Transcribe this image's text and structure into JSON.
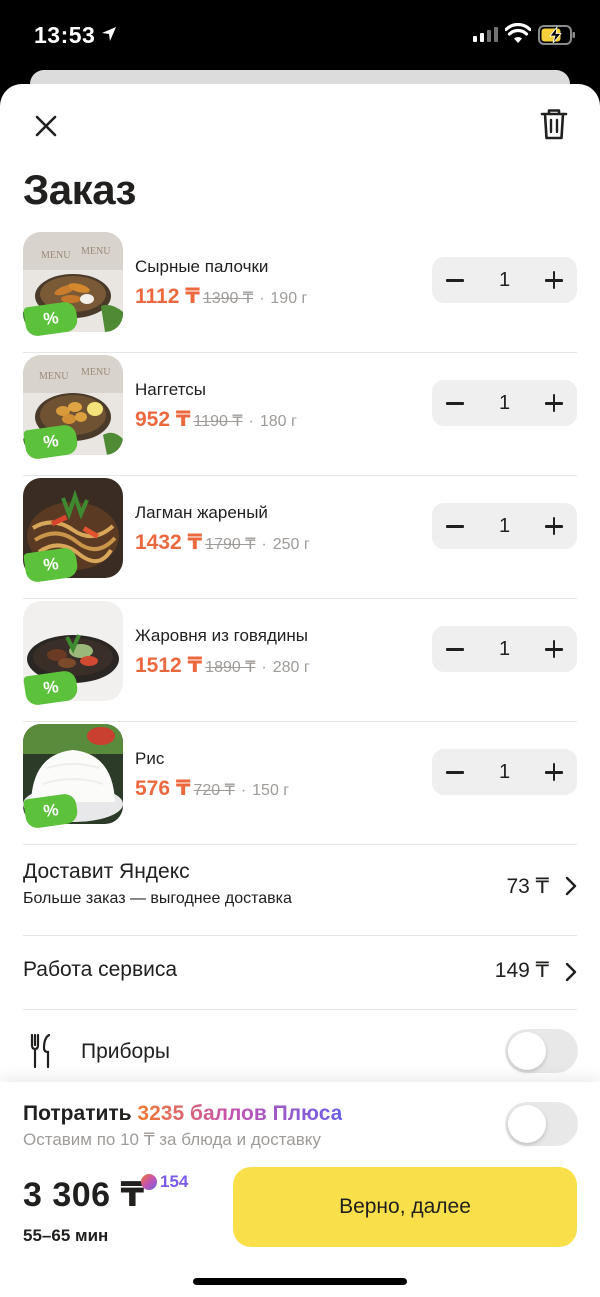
{
  "status_bar": {
    "time": "13:53"
  },
  "header": {
    "title": "Заказ"
  },
  "items": [
    {
      "name": "Сырные палочки",
      "price": "1112 ₸",
      "old_price": "1390 ₸",
      "separator": "·",
      "weight": "190 г",
      "quantity": "1",
      "badge": "%",
      "image": "cheese-sticks-photo"
    },
    {
      "name": "Наггетсы",
      "price": "952 ₸",
      "old_price": "1190 ₸",
      "separator": "·",
      "weight": "180 г",
      "quantity": "1",
      "badge": "%",
      "image": "nuggets-photo"
    },
    {
      "name": "Лагман жареный",
      "price": "1432 ₸",
      "old_price": "1790 ₸",
      "separator": "·",
      "weight": "250 г",
      "quantity": "1",
      "badge": "%",
      "image": "lagman-photo"
    },
    {
      "name": "Жаровня из говядины",
      "price": "1512 ₸",
      "old_price": "1890 ₸",
      "separator": "·",
      "weight": "280 г",
      "quantity": "1",
      "badge": "%",
      "image": "beef-skillet-photo"
    },
    {
      "name": "Рис",
      "price": "576 ₸",
      "old_price": "720 ₸",
      "separator": "·",
      "weight": "150 г",
      "quantity": "1",
      "badge": "%",
      "image": "rice-photo"
    }
  ],
  "delivery": {
    "title": "Доставит Яндекс",
    "subtitle": "Больше заказ — выгоднее доставка",
    "value": "73 ₸"
  },
  "service": {
    "title": "Работа сервиса",
    "value": "149 ₸"
  },
  "cutlery": {
    "label": "Приборы",
    "enabled": false
  },
  "plus": {
    "prefix": "Потратить ",
    "highlight": "3235 баллов Плюса",
    "subtitle": "Оставим по 10 ₸ за блюда и доставку",
    "enabled": false
  },
  "footer": {
    "total": "3 306 ₸",
    "cashback": "154",
    "eta": "55–65 мин",
    "cta": "Верно, далее"
  },
  "colors": {
    "accent": "#ec6940",
    "cta": "#f9e04a",
    "badge": "#5cc13b",
    "plus_purple": "#7b5ce8"
  }
}
